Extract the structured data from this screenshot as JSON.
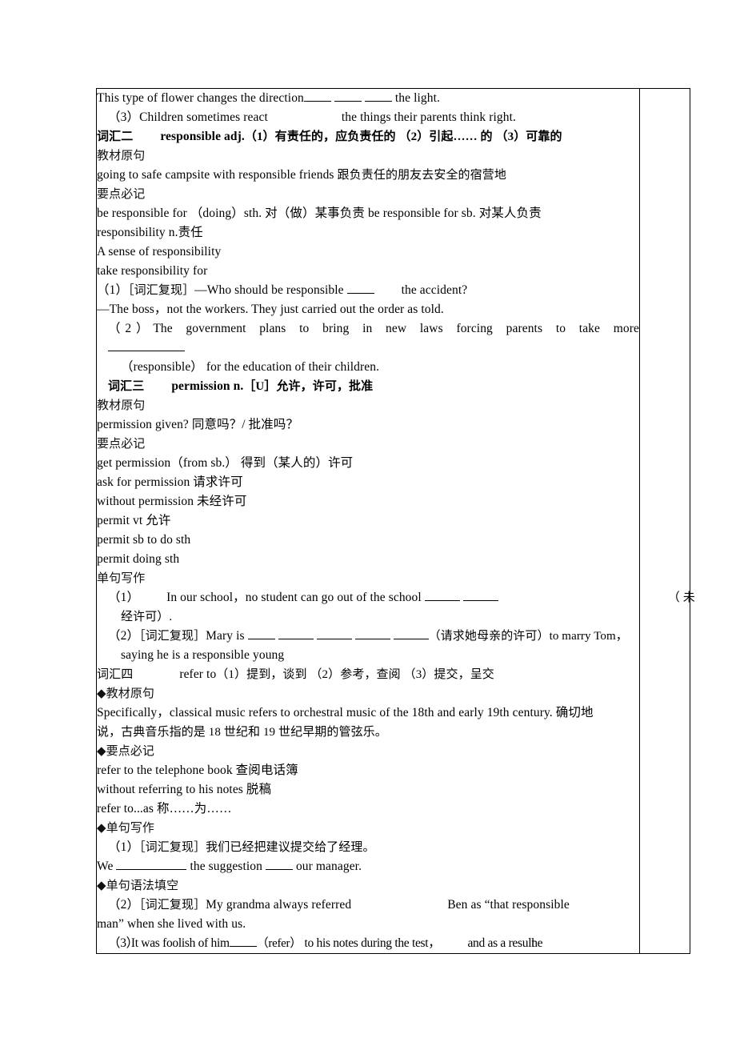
{
  "document": {
    "lines": {
      "l1": "This type of flower changes the direction",
      "l1_tail": "the light.",
      "l2_num": "（3）",
      "l2": "Children sometimes react",
      "l2_tail": "the things their parents think right.",
      "v2_label": "词汇二",
      "v2_entry": "responsible adj.",
      "v2_defs": "（1）有责任的，应负责任的  （2）引起…… 的   （3）可靠的",
      "v2_src_head": "教材原句",
      "v2_src": "going to safe campsite with responsible friends",
      "v2_src_cn": "跟负责任的朋友去安全的宿营地",
      "v2_key_head": "要点必记",
      "v2_key1": "be responsible for （doing）sth. 对（做）某事负责   be responsible for sb. 对某人负责",
      "v2_key2": "responsibility n.责任",
      "v2_key3": "A sense of responsibility",
      "v2_key4": "take responsibility for",
      "v2_q1_num": "（1）",
      "v2_q1_tag": "［词汇复现］",
      "v2_q1_a": "—Who should be responsible",
      "v2_q1_b": "the accident?",
      "v2_q1_ans": "—The boss，not the workers. They just carried out the order as told.",
      "v2_q2_num": "（2）",
      "v2_q2": "The government plans to bring in new laws forcing parents to take more",
      "v2_q2_cont": "（responsible）  for the education of their children.",
      "v3_label": "词汇三",
      "v3_entry": "permission n.",
      "v3_defs": "［U］允许，许可，批准",
      "v3_src_head": "教材原句",
      "v3_src": "permission given? 同意吗？/ 批准吗？",
      "v3_key_head": "要点必记",
      "v3_key1": "get permission（from sb.） 得到（某人的）许可",
      "v3_key2": "ask for permission 请求许可",
      "v3_key3": "without permission 未经许可",
      "v3_key4": "permit vt 允许",
      "v3_key5": "permit sb to do sth",
      "v3_key6": "permit doing sth",
      "v3_write_head": "单句写作",
      "v3_q1_num": "（1）",
      "v3_q1": "In our school，no student can go out of the school",
      "v3_q1_tail": "（ 未",
      "v3_q1_cont": "经许可）.",
      "v3_q2_num": "（2）",
      "v3_q2_tag": "［词汇复现］",
      "v3_q2_a": "Mary is",
      "v3_q2_b": "（请求她母亲的许可）to marry Tom，",
      "v3_q2_cont": "saying he is a responsible young",
      "v4_label": "词汇四",
      "v4_entry": "refer to",
      "v4_defs": "（1）提到，谈到 （2）参考，查阅 （3）提交，呈交",
      "v4_src_head": "◆教材原句",
      "v4_src_a": "Specifically，classical music refers to orchestral music of the 18th and early 19th century. 确切地",
      "v4_src_b": "说，古典音乐指的是 18 世纪和 19 世纪早期的管弦乐。",
      "v4_key_head": "◆要点必记",
      "v4_key1": "refer to the telephone book 查阅电话簿",
      "v4_key2": "without referring to his notes 脱稿",
      "v4_key3": "refer to...as 称……为……",
      "v4_write_head": "◆单句写作",
      "v4_q1_num": "（1）",
      "v4_q1_tag": "［词汇复现］",
      "v4_q1_cn": "我们已经把建议提交给了经理。",
      "v4_q1_a": "We",
      "v4_q1_b": "the suggestion",
      "v4_q1_c": "our manager.",
      "v4_gram_head": "◆单句语法填空",
      "v4_q2_num": "（2）",
      "v4_q2_tag": "［词汇复现］",
      "v4_q2_a": "My grandma always referred",
      "v4_q2_b": "Ben as “that responsible",
      "v4_q2_cont": "man” when she lived with us.",
      "v4_q3_num": "（3）",
      "v4_q3_a": "It was foolish of him",
      "v4_q3_b": "（refer）",
      "v4_q3_c": "to his notes during the test，",
      "v4_q3_d": "and as a result",
      "v4_q3_e": "he"
    }
  }
}
